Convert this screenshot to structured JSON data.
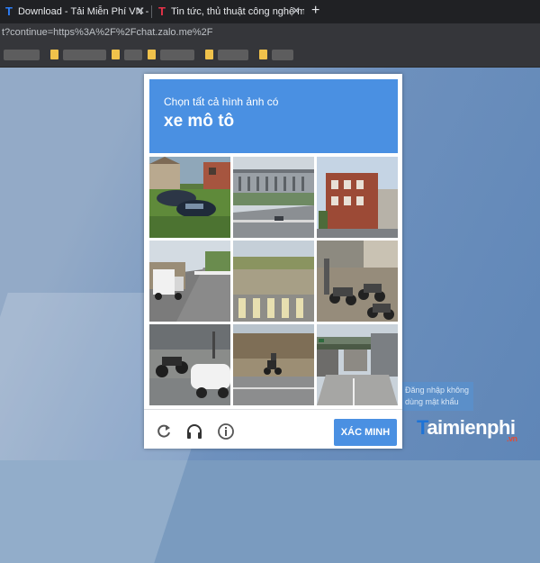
{
  "browser": {
    "tabs": [
      {
        "label": "Download - Tải Miễn Phí VN - Ph",
        "favicon": "T",
        "favicon_color": "#2d7ff9"
      },
      {
        "label": "Tin tức, thủ thuật công nghệ mớ",
        "favicon": "T",
        "favicon_color": "#e8334a"
      }
    ],
    "new_tab_label": "+",
    "address": "t?continue=https%3A%2F%2Fchat.zalo.me%2F"
  },
  "captcha": {
    "instruction": "Chọn tất cả hình ảnh có",
    "target": "xe mô tô",
    "tiles": [
      {
        "name": "tile-1",
        "scene": "houses-with-cars"
      },
      {
        "name": "tile-2",
        "scene": "highway-stadium"
      },
      {
        "name": "tile-3",
        "scene": "brick-building"
      },
      {
        "name": "tile-4",
        "scene": "street-truck"
      },
      {
        "name": "tile-5",
        "scene": "crosswalk-plaza"
      },
      {
        "name": "tile-6",
        "scene": "parked-motorcycles"
      },
      {
        "name": "tile-7",
        "scene": "motorcycles-car"
      },
      {
        "name": "tile-8",
        "scene": "rider-road"
      },
      {
        "name": "tile-9",
        "scene": "overpass-street"
      }
    ],
    "reload_icon": "reload-icon",
    "audio_icon": "headphones-icon",
    "info_icon": "info-icon",
    "verify_label": "XÁC MINH",
    "accent": "#4a90e2"
  },
  "background": {
    "hint_text": "Đăng nhập không dùng mật khẩu",
    "brand": {
      "first": "T",
      "rest": "aimienphi",
      "suffix": ".vn"
    }
  }
}
